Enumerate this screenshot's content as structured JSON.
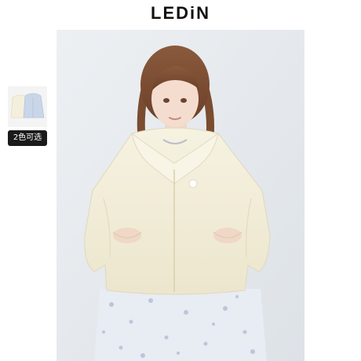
{
  "brand": {
    "logo_text": "LEDiN"
  },
  "color_options": {
    "badge_label": "2色可选",
    "swatches": [
      "cream",
      "light-blue"
    ]
  },
  "product_image": {
    "icon": "product-photo"
  },
  "colors": {
    "background": "#ffffff",
    "badge_bg": "#1a1a1a",
    "badge_text": "#ffffff",
    "jacket_cream": "#f3efdc",
    "jacket_blue": "#c9d6ea"
  }
}
